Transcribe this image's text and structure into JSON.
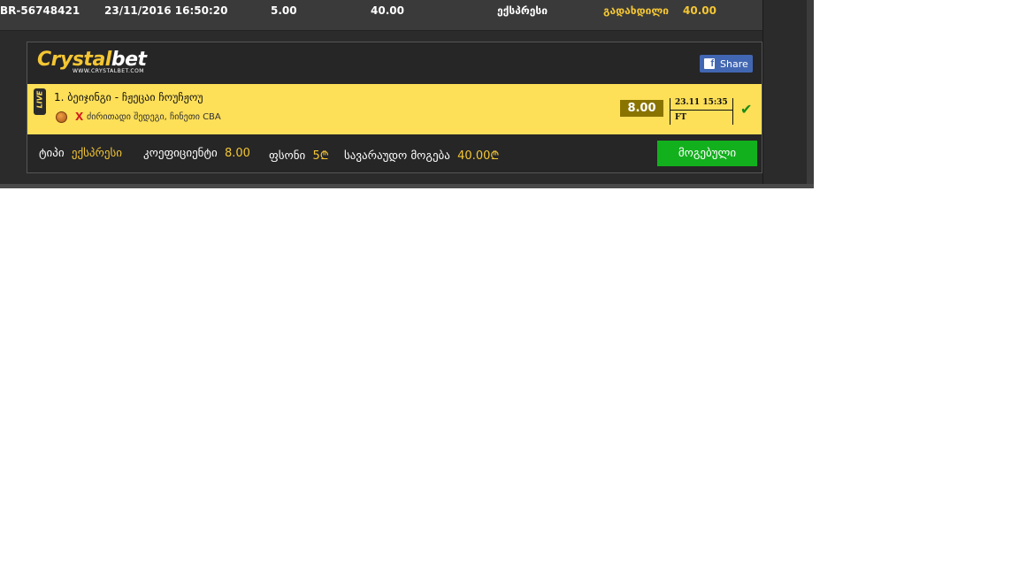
{
  "top_row": {
    "id": "BR-56748421",
    "date": "23/11/2016 16:50:20",
    "stake": "5.00",
    "possible_win": "40.00",
    "type": "ექსპრესი",
    "status": "გადახდილი",
    "amount": "40.00"
  },
  "card": {
    "logo_part1": "Crystal",
    "logo_part2": "bet",
    "logo_sub": "WWW.CRYSTALBET.COM",
    "share_icon": "facebook-icon",
    "share_label": "Share",
    "bet": {
      "live_label": "LIVE",
      "match": "1. ბეიჯინგი - ჩჟეცაი ჩოუჩჟოუ",
      "sport_icon": "basketball-icon",
      "pick": "X",
      "league": "ძირითადი შედეგი, ჩინეთი CBA",
      "odds": "8.00",
      "datetime": "23.11 15:35",
      "status": "FT",
      "check_icon": "checkmark-icon"
    },
    "summary": {
      "type_label": "ტიპი",
      "type_value": "ექსპრესი",
      "coef_label": "კოეფიციენტი",
      "coef_value": "8.00",
      "stake_label": "ფსონი",
      "stake_value": "5₾",
      "possible_label": "სავარაუდო მოგება",
      "possible_value": "40.00₾"
    },
    "won_label": "მოგებული"
  },
  "colors": {
    "accent_yellow": "#f4c634",
    "bet_row_bg": "#fddf58",
    "won_green": "#13b01e",
    "facebook_blue": "#4267b2"
  }
}
